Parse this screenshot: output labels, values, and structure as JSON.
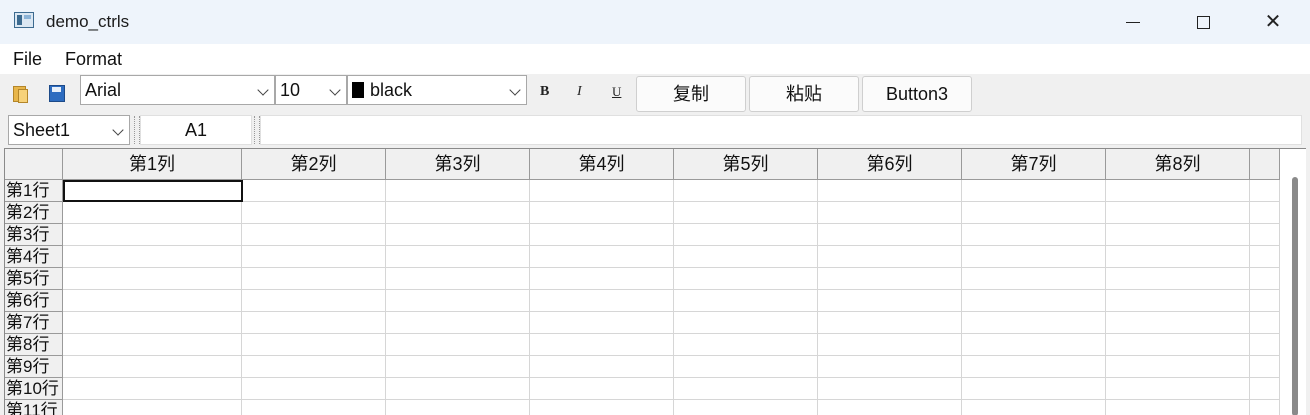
{
  "window": {
    "title": "demo_ctrls"
  },
  "menu": {
    "file": "File",
    "format": "Format"
  },
  "toolbar": {
    "font": "Arial",
    "size": "10",
    "color": "black",
    "color_swatch": "#000000",
    "bold": "B",
    "italic": "I",
    "underline": "U",
    "buttons": [
      "复制",
      "粘贴",
      "Button3"
    ]
  },
  "formula_bar": {
    "sheet": "Sheet1",
    "cell_ref": "A1",
    "formula": ""
  },
  "grid": {
    "columns": [
      "第1列",
      "第2列",
      "第3列",
      "第4列",
      "第5列",
      "第6列",
      "第7列",
      "第8列"
    ],
    "rows": [
      "第1行",
      "第2行",
      "第3行",
      "第4行",
      "第5行",
      "第6行",
      "第7行",
      "第8行",
      "第9行",
      "第10行",
      "第11行"
    ]
  }
}
